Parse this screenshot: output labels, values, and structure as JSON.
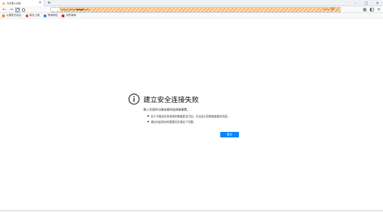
{
  "tab": {
    "title": "无法载入页面"
  },
  "address_bar": {
    "url_prefix": "https://www.",
    "url_domain": "tmall",
    "url_suffix": ".com"
  },
  "bookmarks": [
    {
      "label": "火狐官方站点",
      "color": "#ff7a00"
    },
    {
      "label": "新手上路",
      "color": "#ff3b30"
    },
    {
      "label": "常用网址",
      "color": "#3f7fd8"
    },
    {
      "label": "京东商城",
      "color": "#e1251b"
    }
  ],
  "error": {
    "title": "建立安全连接失败",
    "description": "载入页面时与服务器的连接被重置。",
    "bullets": [
      "由于不能验证所收到的数据是否可信，无法显示您想要查看的页面。",
      "建议向此网站的管理员反馈这个问题。"
    ],
    "retry_label": "重试"
  },
  "colors": {
    "accent": "#0a84ff",
    "warning_hatch": "#f7b868"
  }
}
